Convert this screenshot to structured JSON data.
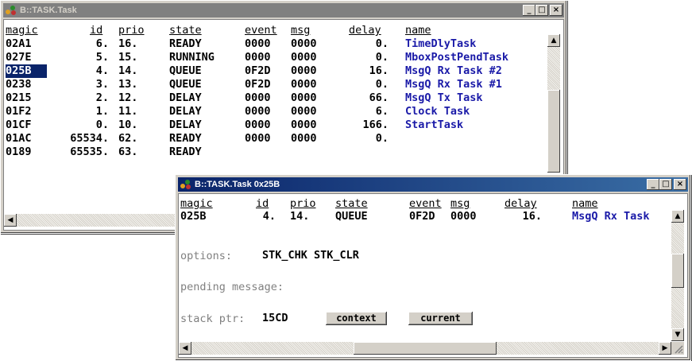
{
  "window1": {
    "title": "B::TASK.Task",
    "headers": [
      "magic",
      "id",
      "prio",
      "state",
      "event",
      "msg",
      "delay",
      "name"
    ],
    "rows": [
      {
        "magic": "02A1",
        "id": "6.",
        "prio": "16.",
        "state": "READY",
        "event": "0000",
        "msg": "0000",
        "delay": "0.",
        "name": "TimeDlyTask"
      },
      {
        "magic": "027E",
        "id": "5.",
        "prio": "15.",
        "state": "RUNNING",
        "event": "0000",
        "msg": "0000",
        "delay": "0.",
        "name": "MboxPostPendTask"
      },
      {
        "magic": "025B",
        "id": "4.",
        "prio": "14.",
        "state": "QUEUE",
        "event": "0F2D",
        "msg": "0000",
        "delay": "16.",
        "name": "MsgQ Rx Task #2"
      },
      {
        "magic": "0238",
        "id": "3.",
        "prio": "13.",
        "state": "QUEUE",
        "event": "0F2D",
        "msg": "0000",
        "delay": "0.",
        "name": "MsgQ Rx Task #1"
      },
      {
        "magic": "0215",
        "id": "2.",
        "prio": "12.",
        "state": "DELAY",
        "event": "0000",
        "msg": "0000",
        "delay": "66.",
        "name": "MsgQ Tx Task"
      },
      {
        "magic": "01F2",
        "id": "1.",
        "prio": "11.",
        "state": "DELAY",
        "event": "0000",
        "msg": "0000",
        "delay": "6.",
        "name": "Clock Task"
      },
      {
        "magic": "01CF",
        "id": "0.",
        "prio": "10.",
        "state": "DELAY",
        "event": "0000",
        "msg": "0000",
        "delay": "166.",
        "name": "StartTask"
      },
      {
        "magic": "01AC",
        "id": "65534.",
        "prio": "62.",
        "state": "READY",
        "event": "0000",
        "msg": "0000",
        "delay": "0.",
        "name": ""
      },
      {
        "magic": "0189",
        "id": "65535.",
        "prio": "63.",
        "state": "READY",
        "event": "",
        "msg": "",
        "delay": "",
        "name": ""
      }
    ],
    "selected_magic_row": 2
  },
  "window2": {
    "title": "B::TASK.Task 0x25B",
    "headers": [
      "magic",
      "id",
      "prio",
      "state",
      "event",
      "msg",
      "delay",
      "name"
    ],
    "row": {
      "magic": "025B",
      "id": "4.",
      "prio": "14.",
      "state": "QUEUE",
      "event": "0F2D",
      "msg": "0000",
      "delay": "16.",
      "name": "MsgQ Rx Task"
    },
    "options_label": "options:",
    "options_value": "STK_CHK STK_CLR",
    "pending_label": "pending message:",
    "stack_label": "stack ptr:",
    "stack_value": "15CD",
    "context_button": "context",
    "current_button": "current"
  },
  "window_buttons": {
    "minimize": "_",
    "maximize": "□",
    "close": "×"
  },
  "colors": {
    "active_title": "#0a246a",
    "inactive_title": "#808080",
    "name_text": "#1a1aa8",
    "selection": "#0a246a"
  },
  "icons": [
    "app-icon",
    "arrow-up-icon",
    "arrow-down-icon",
    "arrow-left-icon",
    "arrow-right-icon",
    "size-grip-icon"
  ]
}
